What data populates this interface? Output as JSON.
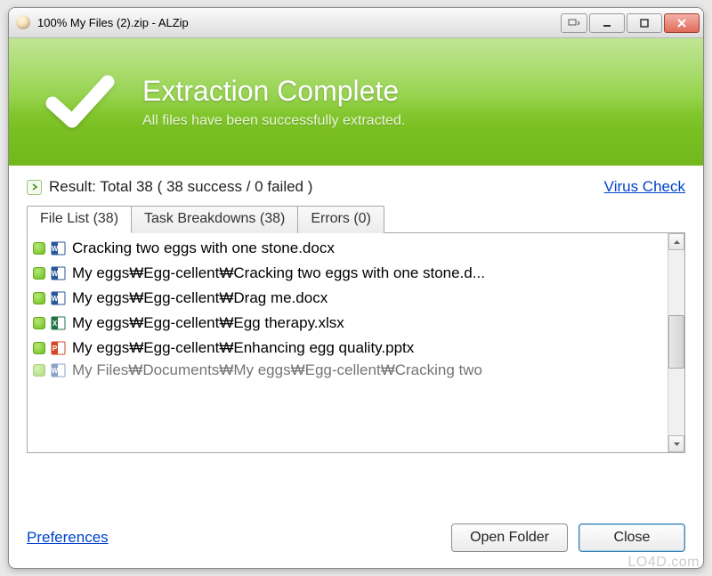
{
  "window": {
    "title": "100% My Files (2).zip - ALZip"
  },
  "banner": {
    "heading": "Extraction Complete",
    "subheading": "All files have been successfully extracted."
  },
  "result": {
    "text": "Result: Total 38 ( 38 success / 0 failed )",
    "virus_check": "Virus Check"
  },
  "tabs": {
    "file_list": "File List (38)",
    "task_breakdowns": "Task Breakdowns (38)",
    "errors": "Errors (0)"
  },
  "files": [
    {
      "icon": "word",
      "name": "Cracking two eggs with one stone.docx"
    },
    {
      "icon": "word",
      "name": "My eggs₩Egg-cellent₩Cracking two eggs with one stone.d..."
    },
    {
      "icon": "word",
      "name": "My eggs₩Egg-cellent₩Drag me.docx"
    },
    {
      "icon": "excel",
      "name": "My eggs₩Egg-cellent₩Egg therapy.xlsx"
    },
    {
      "icon": "ppt",
      "name": "My eggs₩Egg-cellent₩Enhancing egg quality.pptx"
    },
    {
      "icon": "word",
      "name": "My Files₩Documents₩My eggs₩Egg-cellent₩Cracking two"
    }
  ],
  "footer": {
    "preferences": "Preferences",
    "open_folder": "Open Folder",
    "close": "Close"
  },
  "watermark": "LO4D.com"
}
